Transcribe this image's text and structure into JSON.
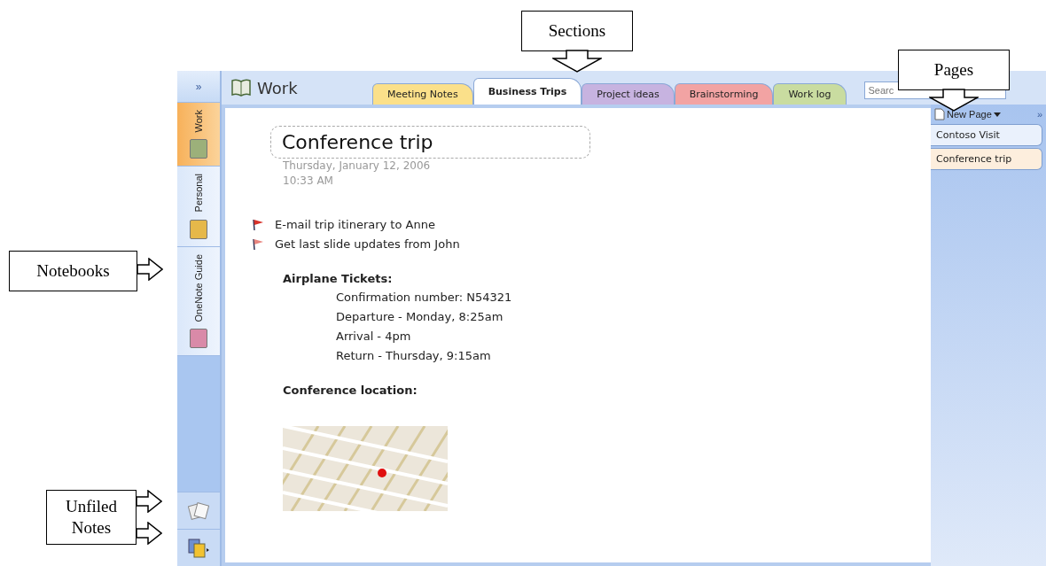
{
  "callouts": [
    {
      "label": "Sections",
      "kind": "down"
    },
    {
      "label": "Pages",
      "kind": "down"
    },
    {
      "label": "Notebooks",
      "kind": "right"
    },
    {
      "label": "Unfiled Notes",
      "kind": "double-right"
    }
  ],
  "navigation": {
    "expand": "»",
    "notebooks": [
      {
        "label": "Work",
        "color": "#9cb07a",
        "selected": true
      },
      {
        "label": "Personal",
        "color": "#e6b84a",
        "selected": false
      },
      {
        "label": "OneNote Guide",
        "color": "#d98aa8",
        "selected": false
      }
    ]
  },
  "notebook_title": "Work",
  "sections": [
    {
      "label": "Meeting Notes",
      "color": "#fbe08a",
      "selected": false
    },
    {
      "label": "Business Trips",
      "color": "#ffffff",
      "selected": true
    },
    {
      "label": "Project ideas",
      "color": "#c7b3e0",
      "selected": false
    },
    {
      "label": "Brainstorming",
      "color": "#f2a3a3",
      "selected": false
    },
    {
      "label": "Work log",
      "color": "#c9dca0",
      "selected": false
    }
  ],
  "search": {
    "placeholder": "Searc"
  },
  "page": {
    "title": "Conference trip",
    "date": "Thursday, January 12, 2006",
    "time": "10:33 AM",
    "tasks": [
      {
        "text": "E-mail trip itinerary to Anne",
        "color": "#d8322a"
      },
      {
        "text": "Get last slide updates from John",
        "color": "#e8857f"
      }
    ],
    "blocks": [
      {
        "heading": "Airplane Tickets:",
        "lines": [
          "Confirmation number: N54321",
          "Departure - Monday, 8:25am",
          "Arrival - 4pm",
          "Return - Thursday, 9:15am"
        ]
      },
      {
        "heading": "Conference location:"
      }
    ]
  },
  "pages": {
    "new_page": "New Page",
    "expand": "»",
    "items": [
      {
        "label": "Contoso Visit",
        "selected": false
      },
      {
        "label": "Conference trip",
        "selected": true
      }
    ]
  }
}
